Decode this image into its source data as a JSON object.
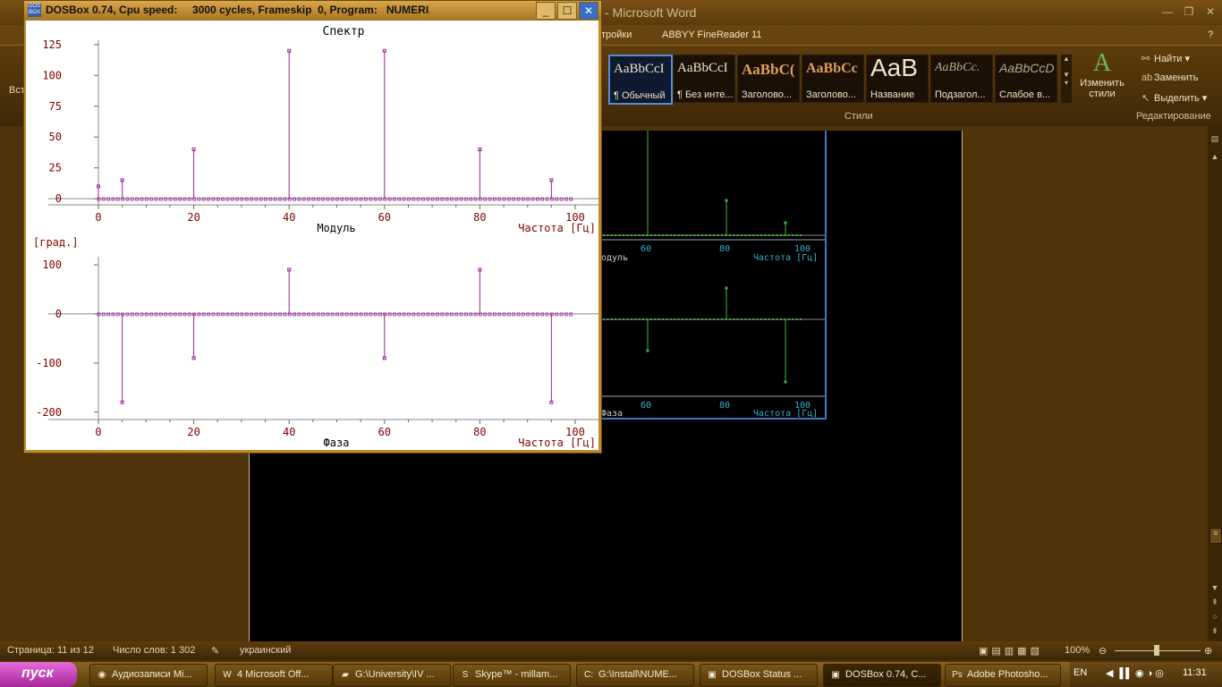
{
  "word": {
    "title": "- Microsoft Word",
    "tabs": [
      "тройки",
      "ABBYY FineReader 11"
    ],
    "left_stub": "Вст",
    "styles": [
      {
        "sample": "AaBbCcI",
        "name": "¶ Обычный",
        "active": true
      },
      {
        "sample": "AaBbCcI",
        "name": "¶ Без инте...",
        "active": false
      },
      {
        "sample": "AaBbC(",
        "name": "Заголово...",
        "active": false
      },
      {
        "sample": "AaBbCc",
        "name": "Заголово...",
        "active": false
      },
      {
        "sample": "AaB",
        "name": "Название",
        "active": false
      },
      {
        "sample": "AaBbCc.",
        "name": "Подзагол...",
        "active": false
      },
      {
        "sample": "AaBbCcD",
        "name": "Слабое в...",
        "active": false
      }
    ],
    "change_styles": "Изменить стили",
    "styles_group": "Стили",
    "edit_group": "Редактирование",
    "find": "Найти",
    "replace": "Заменить",
    "select": "Выделить",
    "status": {
      "page": "Страница: 11 из 12",
      "words": "Число слов: 1 302",
      "language": "украинский",
      "zoom": "100%"
    },
    "embed_labels": {
      "x_ticks": [
        "60",
        "80",
        "100"
      ],
      "x_label": "Частота [Гц]",
      "top_caption": "одуль",
      "bottom_caption": "Фаза"
    }
  },
  "dosbox": {
    "title": "DOSBox 0.74, Cpu speed:     3000 cycles, Frameskip  0, Program:   NUMERI",
    "icon": "DOS BOX"
  },
  "chart_data": [
    {
      "type": "bar",
      "title": "Спектр",
      "xlabel": "Частота [Гц]",
      "caption": "Модуль",
      "ylabel": "",
      "x_ticks": [
        0,
        20,
        40,
        60,
        80,
        100
      ],
      "y_ticks": [
        0,
        25,
        50,
        75,
        100,
        125
      ],
      "xlim": [
        -5,
        105
      ],
      "ylim": [
        -5,
        130
      ],
      "baseline_points": {
        "from": 0,
        "to": 99,
        "step": 1
      },
      "x": [
        0,
        5,
        20,
        40,
        60,
        80,
        95
      ],
      "values": [
        10,
        15,
        40,
        120,
        120,
        40,
        15
      ],
      "color": "#a020a0"
    },
    {
      "type": "bar",
      "title": "",
      "xlabel": "Частота [Гц]",
      "caption": "Фаза",
      "ylabel": "[град.]",
      "x_ticks": [
        0,
        20,
        40,
        60,
        80,
        100
      ],
      "y_ticks": [
        -200,
        -100,
        0,
        100
      ],
      "xlim": [
        -5,
        105
      ],
      "ylim": [
        -215,
        120
      ],
      "baseline_points": {
        "from": 0,
        "to": 99,
        "step": 1
      },
      "x": [
        5,
        20,
        40,
        60,
        80,
        95
      ],
      "values": [
        -180,
        -90,
        90,
        -90,
        90,
        -180
      ],
      "color": "#a020a0"
    }
  ],
  "taskbar": {
    "start": "пуск",
    "items": [
      {
        "icon": "chrome-icon",
        "label": "Аудиозаписи Mi...",
        "active": false
      },
      {
        "icon": "word-icon",
        "label": "4 Microsoft Off...",
        "active": false
      },
      {
        "icon": "folder-icon",
        "label": "G:\\University\\IV ...",
        "active": false
      },
      {
        "icon": "skype-icon",
        "label": "Skype™ - millam...",
        "active": false
      },
      {
        "icon": "cmd-icon",
        "label": "G:\\Install\\NUME...",
        "active": false
      },
      {
        "icon": "dosbox-icon",
        "label": "DOSBox Status ...",
        "active": false
      },
      {
        "icon": "dosbox-icon",
        "label": "DOSBox 0.74, C...",
        "active": true
      },
      {
        "icon": "photoshop-icon",
        "label": "Adobe Photosho...",
        "active": false
      }
    ],
    "lang": "EN",
    "clock": "11:31"
  }
}
